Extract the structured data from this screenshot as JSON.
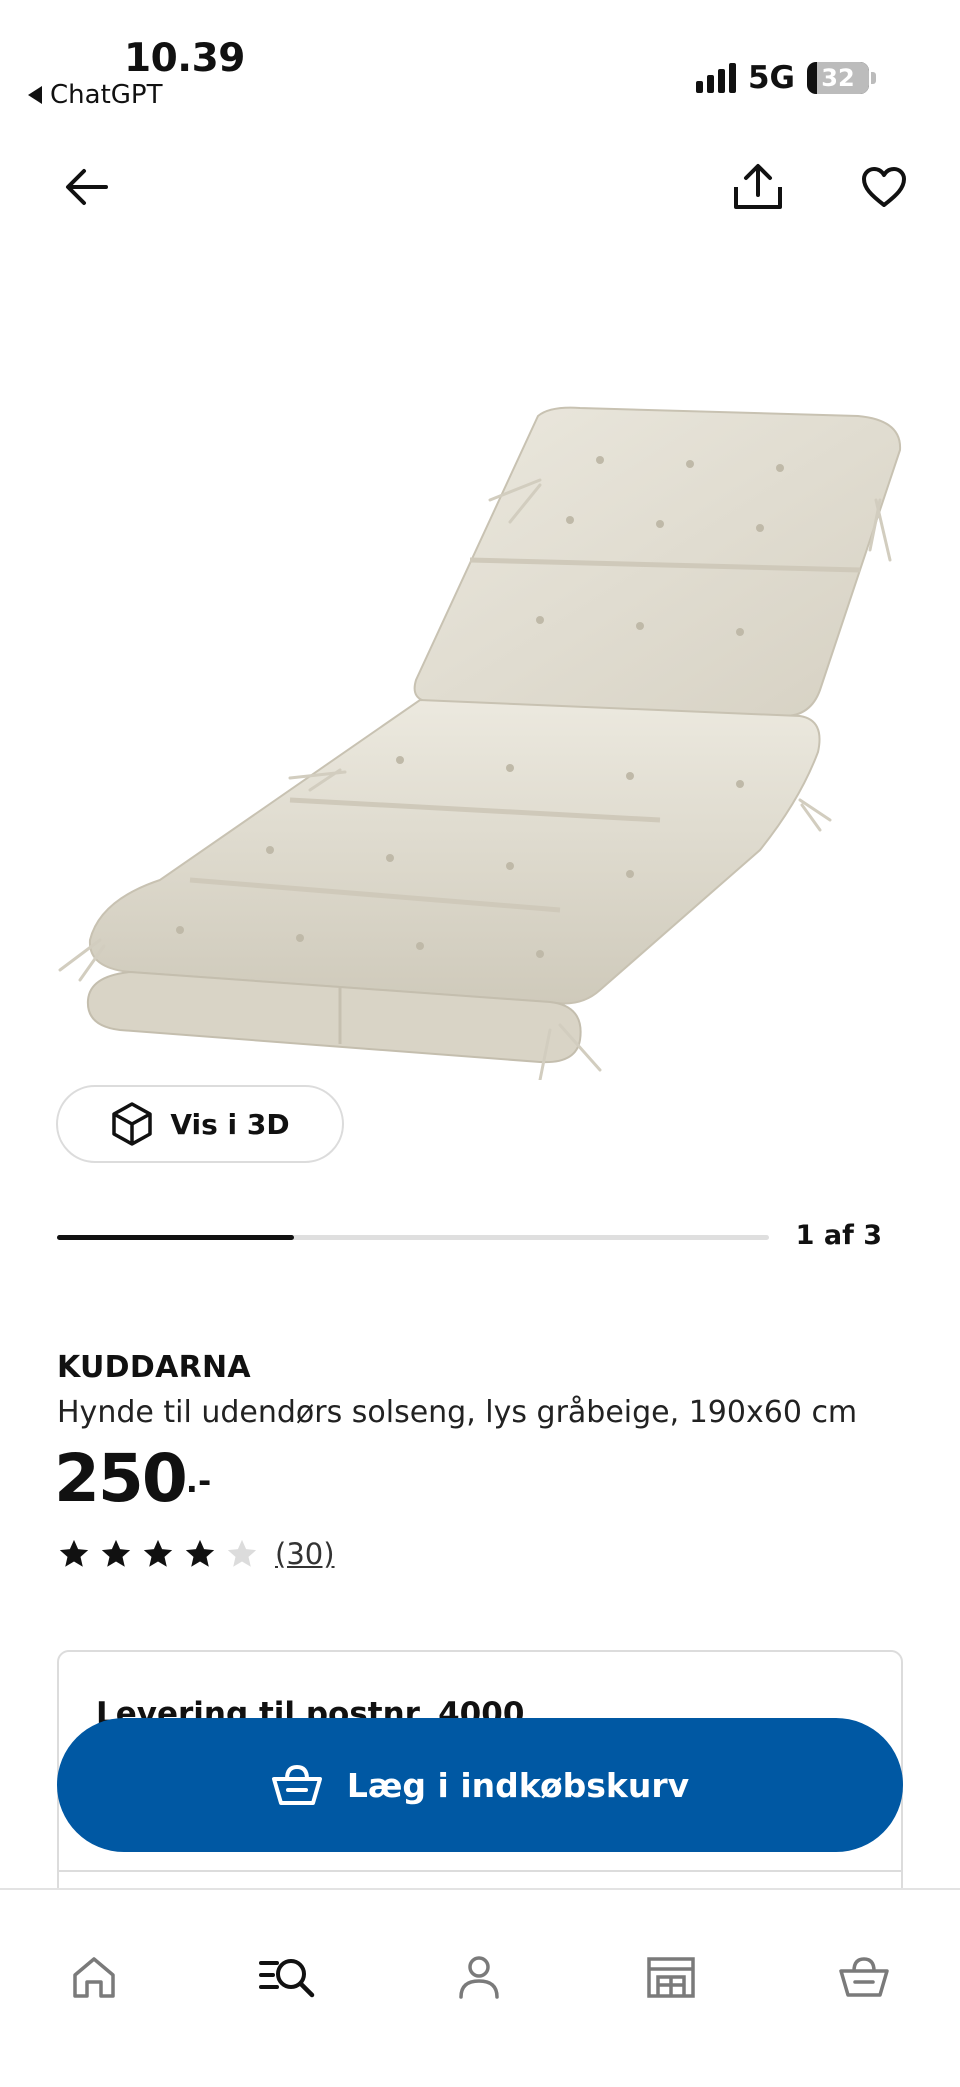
{
  "status_bar": {
    "time": "10.39",
    "back_app": "ChatGPT",
    "network": "5G",
    "battery": "32"
  },
  "top_nav": {
    "back_icon": "arrow-left-icon",
    "share_icon": "share-icon",
    "favorite_icon": "heart-icon"
  },
  "gallery": {
    "view_3d_label": "Vis i 3D",
    "view_3d_icon": "cube-icon",
    "current": 1,
    "total": 3,
    "counter_label": "1 af 3"
  },
  "product": {
    "name": "KUDDARNA",
    "description": "Hynde til udendørs solseng, lys gråbeige, 190x60 cm",
    "price": "250",
    "price_suffix": ".-",
    "rating": 4,
    "rating_max": 5,
    "review_count": "(30)"
  },
  "delivery": {
    "title": "Levering til postnr. 4000"
  },
  "cart_button": {
    "label": "Læg i indkøbskurv",
    "icon": "basket-icon"
  },
  "tab_bar": {
    "items": [
      {
        "name": "home",
        "icon": "home-icon"
      },
      {
        "name": "search",
        "icon": "search-list-icon"
      },
      {
        "name": "profile",
        "icon": "person-icon"
      },
      {
        "name": "store",
        "icon": "store-icon"
      },
      {
        "name": "basket",
        "icon": "basket-icon"
      }
    ]
  },
  "colors": {
    "brand_blue": "#0058a3",
    "text": "#111111",
    "cushion": "#e6e2d6",
    "star_empty": "#dcdcdc"
  }
}
